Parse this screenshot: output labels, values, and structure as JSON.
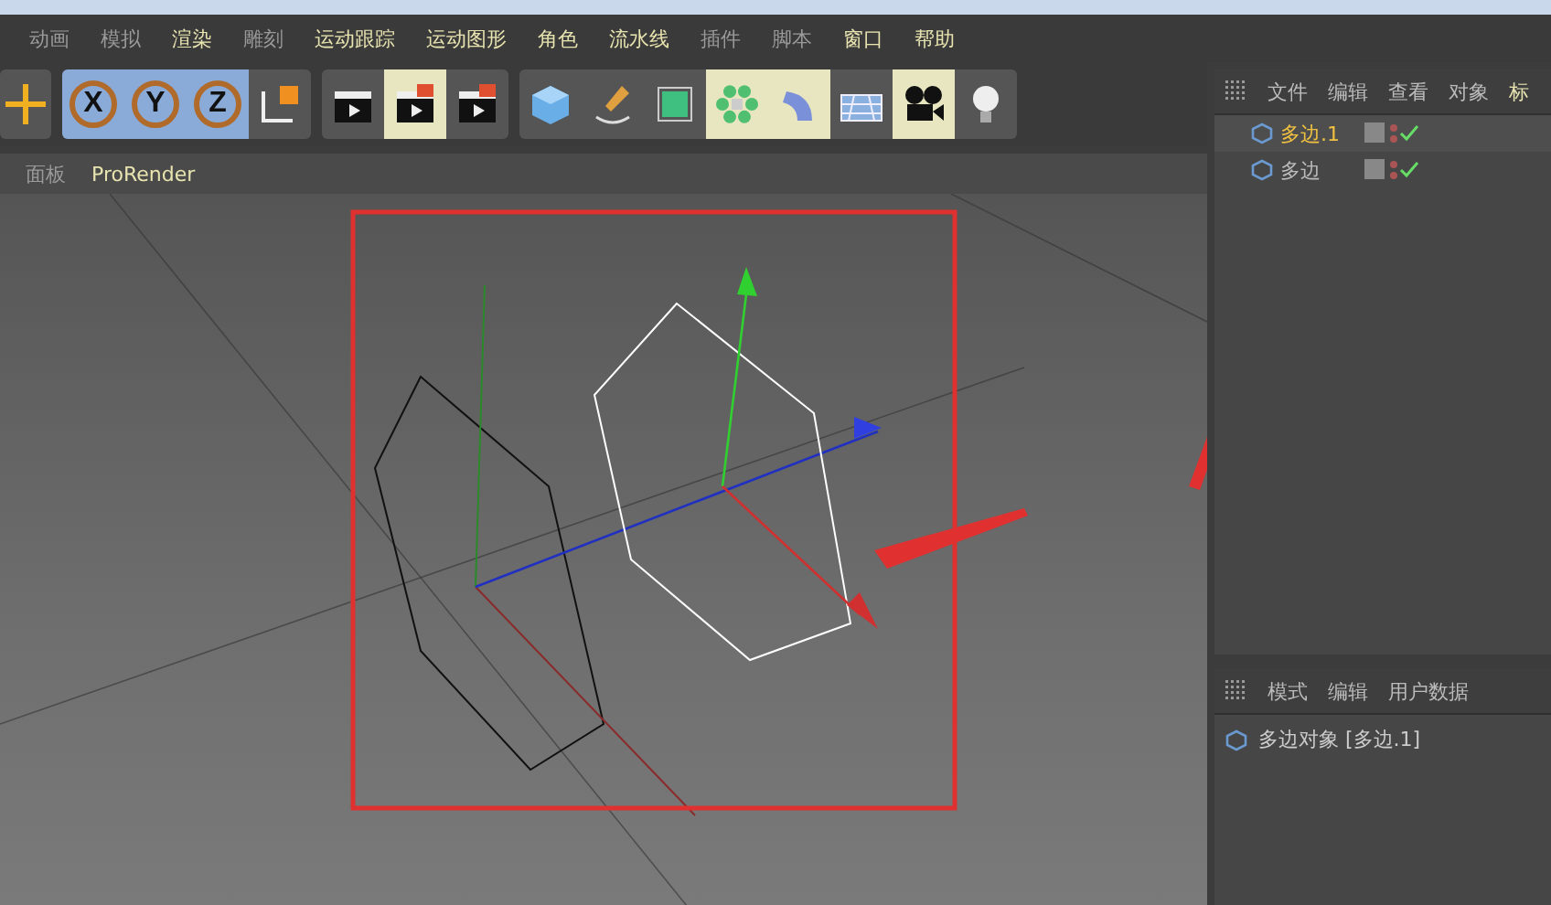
{
  "menu_bar": [
    {
      "label": "动画",
      "highlighted": false
    },
    {
      "label": "模拟",
      "highlighted": false
    },
    {
      "label": "渲染",
      "highlighted": true
    },
    {
      "label": "雕刻",
      "highlighted": false
    },
    {
      "label": "运动跟踪",
      "highlighted": true
    },
    {
      "label": "运动图形",
      "highlighted": true
    },
    {
      "label": "角色",
      "highlighted": true
    },
    {
      "label": "流水线",
      "highlighted": true
    },
    {
      "label": "插件",
      "highlighted": false
    },
    {
      "label": "脚本",
      "highlighted": false
    },
    {
      "label": "窗口",
      "highlighted": true
    },
    {
      "label": "帮助",
      "highlighted": true
    }
  ],
  "axis_buttons": [
    {
      "label": "X",
      "selected": true
    },
    {
      "label": "Y",
      "selected": true
    },
    {
      "label": "Z",
      "selected": true
    }
  ],
  "viewport_tabs": [
    "面板",
    "ProRender"
  ],
  "object_manager": {
    "menu": [
      "文件",
      "编辑",
      "查看",
      "对象",
      "标"
    ],
    "objects": [
      {
        "name": "多边.1",
        "selected": true
      },
      {
        "name": "多边",
        "selected": false
      }
    ]
  },
  "attribute_manager": {
    "menu": [
      "模式",
      "编辑",
      "用户数据"
    ],
    "object_label": "多边对象 [多边.1]"
  }
}
